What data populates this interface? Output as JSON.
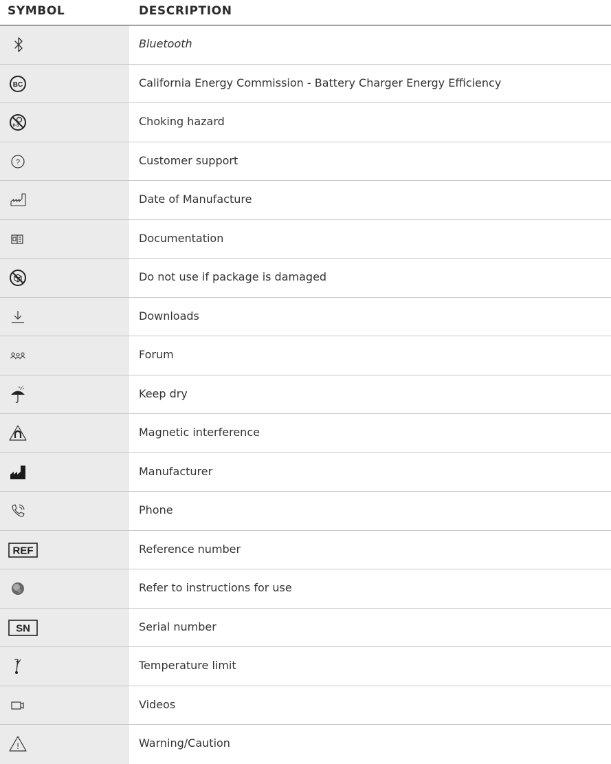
{
  "table": {
    "header": {
      "symbol": "SYMBOL",
      "description": "DESCRIPTION"
    },
    "rows": [
      {
        "icon": "bluetooth-icon",
        "description": "Bluetooth"
      },
      {
        "icon": "bc-circle-icon",
        "description": "California Energy Commission - Battery Charger Energy Efficiency",
        "icon_text": "BC"
      },
      {
        "icon": "choking-hazard-icon",
        "description": "Choking hazard",
        "icon_text": "0-3"
      },
      {
        "icon": "question-circle-icon",
        "description": "Customer support",
        "icon_text": "?"
      },
      {
        "icon": "date-of-manufacture-icon",
        "description": "Date of Manufacture"
      },
      {
        "icon": "documentation-icon",
        "description": "Documentation"
      },
      {
        "icon": "damaged-package-icon",
        "description": "Do not use if package is damaged"
      },
      {
        "icon": "download-icon",
        "description": "Downloads"
      },
      {
        "icon": "forum-icon",
        "description": "Forum"
      },
      {
        "icon": "umbrella-icon",
        "description": "Keep dry"
      },
      {
        "icon": "magnetic-warning-icon",
        "description": "Magnetic interference"
      },
      {
        "icon": "factory-icon",
        "description": "Manufacturer"
      },
      {
        "icon": "phone-icon",
        "description": "Phone"
      },
      {
        "icon": "ref-box-icon",
        "description": "Reference number",
        "icon_text": "REF"
      },
      {
        "icon": "instructions-icon",
        "description": "Refer to instructions for use"
      },
      {
        "icon": "sn-box-icon",
        "description": "Serial number",
        "icon_text": "SN"
      },
      {
        "icon": "thermometer-icon",
        "description": "Temperature limit"
      },
      {
        "icon": "video-icon",
        "description": "Videos"
      },
      {
        "icon": "warning-triangle-icon",
        "description": "Warning/Caution",
        "icon_text": "!"
      }
    ]
  }
}
